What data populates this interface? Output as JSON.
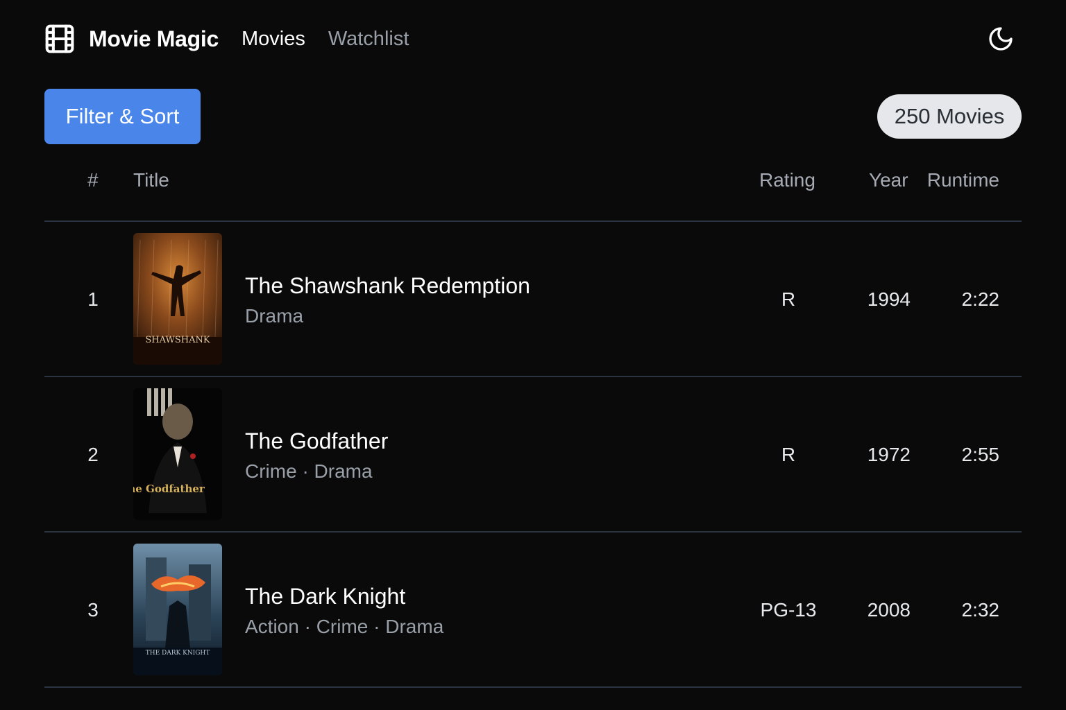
{
  "header": {
    "brand_name": "Movie Magic",
    "brand_icon": "film-icon",
    "nav": [
      {
        "label": "Movies",
        "active": true
      },
      {
        "label": "Watchlist",
        "active": false
      }
    ],
    "theme_icon": "moon-icon"
  },
  "toolbar": {
    "filter_label": "Filter & Sort",
    "count_label": "250 Movies"
  },
  "table": {
    "columns": {
      "num": "#",
      "title": "Title",
      "rating": "Rating",
      "year": "Year",
      "runtime": "Runtime"
    },
    "rows": [
      {
        "num": "1",
        "title": "The Shawshank Redemption",
        "genres": "Drama",
        "rating": "R",
        "year": "1994",
        "runtime": "2:22",
        "poster_text": "SHAWSHANK"
      },
      {
        "num": "2",
        "title": "The Godfather",
        "genres": "Crime · Drama",
        "rating": "R",
        "year": "1972",
        "runtime": "2:55",
        "poster_text": "The Godfather"
      },
      {
        "num": "3",
        "title": "The Dark Knight",
        "genres": "Action · Crime · Drama",
        "rating": "PG-13",
        "year": "2008",
        "runtime": "2:32",
        "poster_text": "THE DARK KNIGHT"
      }
    ]
  },
  "colors": {
    "background": "#0a0a0b",
    "accent": "#4a85ea",
    "badge_bg": "#e5e7eb",
    "divider": "#2b3440",
    "muted_text": "#9aa0a8"
  }
}
